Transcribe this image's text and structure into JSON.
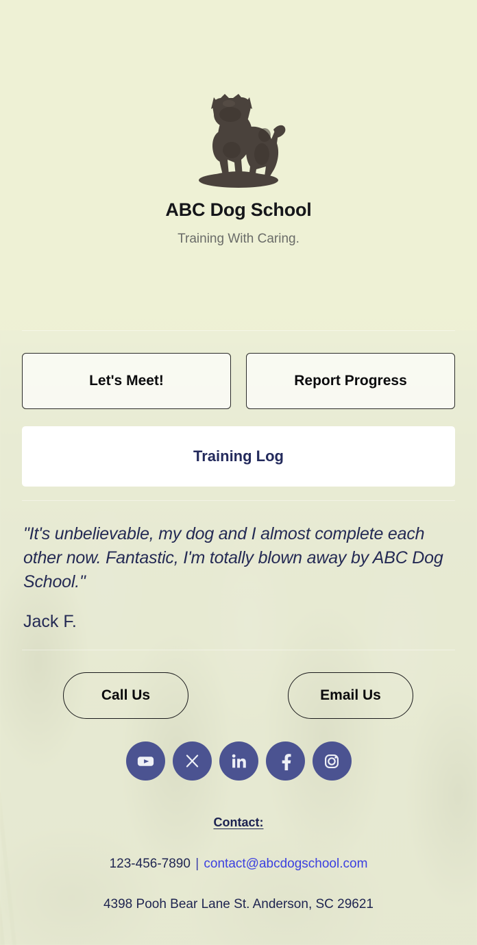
{
  "brand": {
    "logo_icon": "dog-silhouette-logo",
    "title": "ABC Dog School",
    "tagline": "Training With Caring."
  },
  "actions": {
    "lets_meet_label": "Let's Meet!",
    "report_progress_label": "Report Progress",
    "training_log_label": "Training Log"
  },
  "testimonial": {
    "quote": "\"It's unbelievable, my dog and I almost complete each other now. Fantastic, I'm totally blown away by ABC Dog School.\"",
    "author": "Jack F."
  },
  "contact_actions": {
    "call_label": "Call Us",
    "email_label": "Email Us"
  },
  "social": {
    "items": [
      {
        "icon": "youtube-icon",
        "label": "YouTube"
      },
      {
        "icon": "x-twitter-icon",
        "label": "X"
      },
      {
        "icon": "linkedin-icon",
        "label": "LinkedIn"
      },
      {
        "icon": "facebook-icon",
        "label": "Facebook"
      },
      {
        "icon": "instagram-icon",
        "label": "Instagram"
      }
    ]
  },
  "footer": {
    "contact_heading": "Contact:",
    "phone": "123-456-7890",
    "separator": "|",
    "email": "contact@abcdogschool.com",
    "address": "4398 Pooh Bear Lane St. Anderson, SC 29621"
  },
  "colors": {
    "page_background": "#e9ecd4",
    "brand_title": "#15161a",
    "tagline": "#6a6c68",
    "navy_text": "#242a54",
    "link_blue": "#3b3fe0",
    "social_circle": "#4b5391",
    "button_border": "#2a2a28",
    "training_log_bg": "#ffffff",
    "logo_silhouette": "#4a423c"
  }
}
